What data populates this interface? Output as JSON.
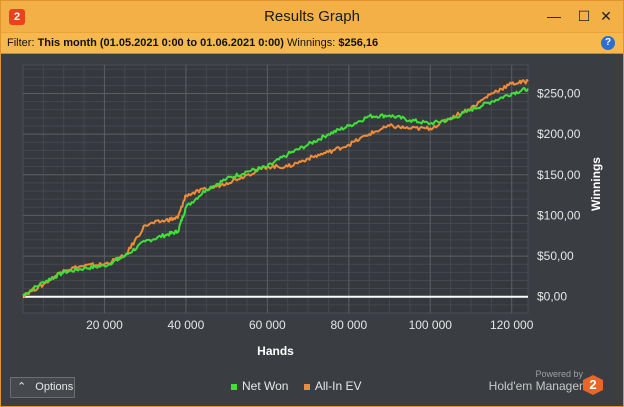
{
  "window": {
    "title": "Results Graph",
    "minimize_glyph": "—",
    "maximize_glyph": "☐",
    "close_glyph": "✕",
    "app_icon_text": "2"
  },
  "filter": {
    "label": "Filter:",
    "value": "This month (01.05.2021 0:00 to 01.06.2021 0:00)",
    "winnings_label": "Winnings:",
    "winnings_value": "$256,16",
    "help_glyph": "?"
  },
  "options_label": "Options",
  "options_glyph": "⌃",
  "branding": {
    "powered_by": "Powered by",
    "name": "Hold'em Manager",
    "logo_text": "2"
  },
  "colors": {
    "background": "#3a3d42",
    "net_won": "#3fe03a",
    "all_in_ev": "#f08c38",
    "zero_line": "#ffffff",
    "window_accent": "#f3b047"
  },
  "chart_data": {
    "type": "line",
    "xlabel": "Hands",
    "ylabel": "Winnings",
    "xlim": [
      0,
      124000
    ],
    "ylim": [
      -20,
      285
    ],
    "x_ticks": [
      20000,
      40000,
      60000,
      80000,
      100000,
      120000
    ],
    "x_tick_labels": [
      "20 000",
      "40 000",
      "60 000",
      "80 000",
      "100 000",
      "120 000"
    ],
    "y_ticks": [
      0,
      50,
      100,
      150,
      200,
      250
    ],
    "y_tick_labels": [
      "$0,00",
      "$50,00",
      "$100,00",
      "$150,00",
      "$200,00",
      "$250,00"
    ],
    "grid": true,
    "legend": "bottom-center",
    "x": [
      0,
      5000,
      10000,
      15000,
      20000,
      25000,
      30000,
      35000,
      38000,
      40000,
      45000,
      50000,
      55000,
      60000,
      65000,
      70000,
      75000,
      80000,
      85000,
      90000,
      95000,
      100000,
      105000,
      110000,
      115000,
      120000,
      124000
    ],
    "series": [
      {
        "name": "Net Won",
        "values": [
          2,
          18,
          30,
          35,
          38,
          50,
          68,
          76,
          80,
          110,
          132,
          145,
          154,
          160,
          175,
          187,
          200,
          210,
          222,
          223,
          217,
          213,
          218,
          230,
          240,
          250,
          256
        ]
      },
      {
        "name": "All-In EV",
        "values": [
          2,
          15,
          33,
          38,
          40,
          50,
          88,
          94,
          97,
          125,
          132,
          140,
          150,
          160,
          160,
          170,
          178,
          187,
          200,
          210,
          207,
          207,
          220,
          232,
          250,
          262,
          265
        ]
      }
    ]
  }
}
